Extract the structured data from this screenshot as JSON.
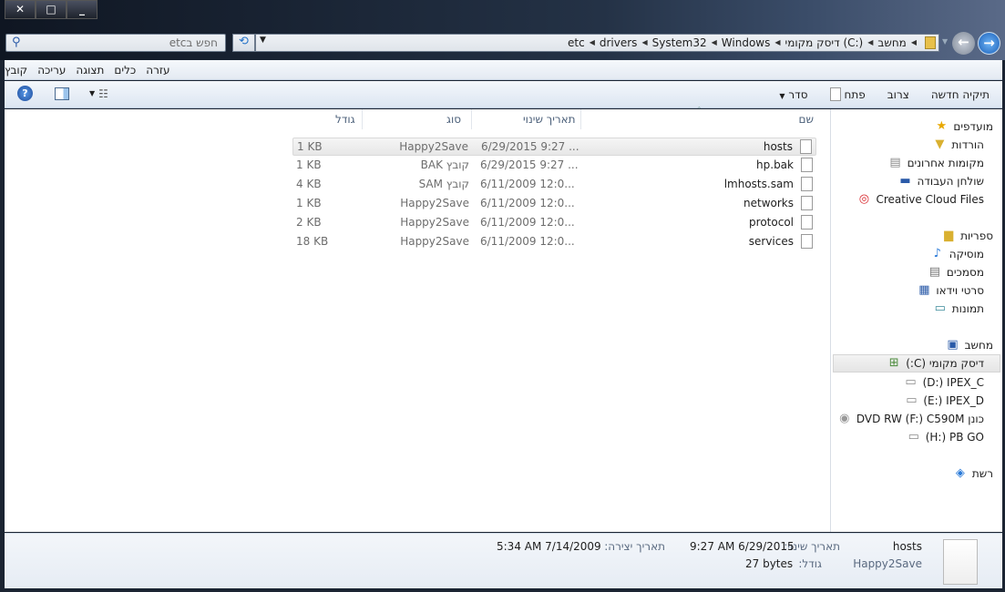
{
  "window": {
    "minimize": "_",
    "maximize": "□",
    "close": "✕"
  },
  "search": {
    "placeholder": "חפש בetc"
  },
  "address": {
    "crumbs": [
      "מחשב",
      "דיסק מקומי (C:)",
      "Windows",
      "System32",
      "drivers",
      "etc"
    ]
  },
  "menu": [
    "קובץ",
    "עריכה",
    "תצוגה",
    "כלים",
    "עזרה"
  ],
  "toolbar": {
    "organize": "סדר",
    "open": "פתח",
    "burn": "צרוב",
    "new_folder": "תיקיה חדשה"
  },
  "columns": {
    "name": "שם",
    "date": "תאריך שינוי",
    "type": "סוג",
    "size": "גודל"
  },
  "files": [
    {
      "name": "hosts",
      "date": "6/29/2015 9:27 ...",
      "type": "Happy2Save",
      "size": "1 KB"
    },
    {
      "name": "hp.bak",
      "date": "6/29/2015 9:27 ...",
      "type": "קובץ BAK",
      "size": "1 KB"
    },
    {
      "name": "lmhosts.sam",
      "date": "6/11/2009 12:0...",
      "type": "קובץ SAM",
      "size": "4 KB"
    },
    {
      "name": "networks",
      "date": "6/11/2009 12:0...",
      "type": "Happy2Save",
      "size": "1 KB"
    },
    {
      "name": "protocol",
      "date": "6/11/2009 12:0...",
      "type": "Happy2Save",
      "size": "2 KB"
    },
    {
      "name": "services",
      "date": "6/11/2009 12:0...",
      "type": "Happy2Save",
      "size": "18 KB"
    }
  ],
  "nav": {
    "favorites": "מועדפים",
    "downloads": "הורדות",
    "recent": "מקומות אחרונים",
    "desktop": "שולחן העבודה",
    "cc": "Creative Cloud Files",
    "libraries": "ספריות",
    "music": "מוסיקה",
    "documents": "מסמכים",
    "videos": "סרטי וידאו",
    "pictures": "תמונות",
    "computer": "מחשב",
    "c": "דיסק מקומי (C:)",
    "d": "(D:) IPEX_C",
    "e": "(E:) IPEX_D",
    "f": "כונן DVD RW (F:) C590M",
    "h": "(H:) PB GO",
    "network": "רשת"
  },
  "details": {
    "name": "hosts",
    "type": "Happy2Save",
    "modified_label": "תאריך שינוי:",
    "modified": "9:27 AM 6/29/2015",
    "size_label": "גודל:",
    "size": "27 bytes",
    "created_label": "תאריך יצירה:",
    "created": "5:34 AM 7/14/2009"
  }
}
